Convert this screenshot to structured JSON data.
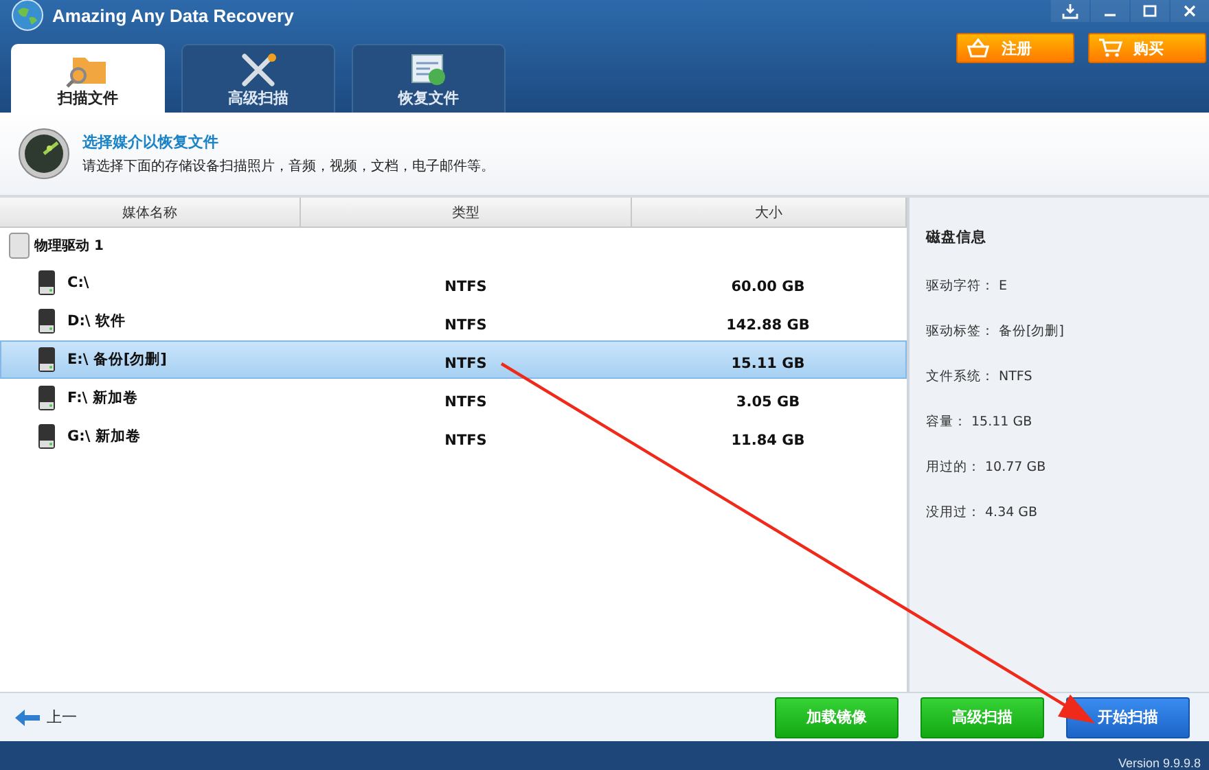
{
  "window": {
    "title": "Amazing Any Data Recovery"
  },
  "header_buttons": [
    {
      "label": "注册",
      "kind": "register"
    },
    {
      "label": "购买",
      "kind": "buy"
    }
  ],
  "tabs": [
    {
      "label": "扫描文件",
      "kind": "scan",
      "selected": true
    },
    {
      "label": "高级扫描",
      "kind": "advanced",
      "selected": false
    },
    {
      "label": "恢复文件",
      "kind": "recover",
      "selected": false
    }
  ],
  "info": {
    "title": "选择媒介以恢复文件",
    "subtitle": "请选择下面的存储设备扫描照片，音频，视频，文档，电子邮件等。"
  },
  "table": {
    "columns": [
      "媒体名称",
      "类型",
      "大小"
    ],
    "groups": [
      {
        "label": "物理驱动 1",
        "children": [
          {
            "name": "C:\\",
            "type": "NTFS",
            "size": "60.00 GB",
            "selected": false
          },
          {
            "name": "D:\\ 软件",
            "type": "NTFS",
            "size": "142.88 GB",
            "selected": false
          },
          {
            "name": "E:\\ 备份[勿删]",
            "type": "NTFS",
            "size": "15.11 GB",
            "selected": true
          },
          {
            "name": "F:\\ 新加卷",
            "type": "NTFS",
            "size": "3.05 GB",
            "selected": false
          },
          {
            "name": "G:\\ 新加卷",
            "type": "NTFS",
            "size": "11.84 GB",
            "selected": false
          }
        ]
      }
    ]
  },
  "disk_info": {
    "title": "磁盘信息",
    "fields": [
      {
        "label": "驱动字符：",
        "value": "E"
      },
      {
        "label": "驱动标签：",
        "value": "备份[勿删]"
      },
      {
        "label": "文件系统：",
        "value": "NTFS"
      },
      {
        "label": "容量：",
        "value": "15.11 GB"
      },
      {
        "label": "用过的：",
        "value": "10.77 GB"
      },
      {
        "label": "没用过：",
        "value": "4.34 GB"
      }
    ]
  },
  "back_button": {
    "label": "上一"
  },
  "action_buttons": [
    {
      "label": "加载镜像",
      "kind": "secondary"
    },
    {
      "label": "高级扫描",
      "kind": "secondary"
    },
    {
      "label": "开始扫描",
      "kind": "primary"
    }
  ],
  "status_bar": {
    "version": "Version 9.9.9.8"
  }
}
